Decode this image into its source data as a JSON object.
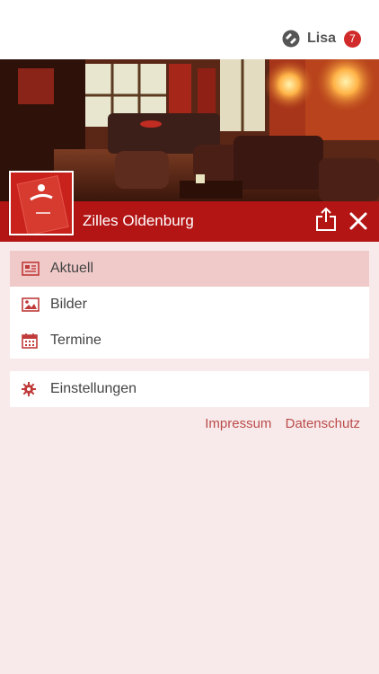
{
  "user": {
    "name": "Lisa",
    "badge_count": "7"
  },
  "venue": {
    "title": "Zilles Oldenburg"
  },
  "menu": {
    "primary": [
      {
        "label": "Aktuell",
        "icon": "newspaper-icon",
        "active": true
      },
      {
        "label": "Bilder",
        "icon": "image-icon",
        "active": false
      },
      {
        "label": "Termine",
        "icon": "calendar-icon",
        "active": false
      }
    ],
    "secondary": [
      {
        "label": "Einstellungen",
        "icon": "gear-icon"
      }
    ]
  },
  "footer_links": {
    "impressum": "Impressum",
    "datenschutz": "Datenschutz"
  },
  "colors": {
    "accent": "#b31414",
    "background": "#f8eaea",
    "active_row": "#f0c9c9",
    "link": "#bb4b4b"
  }
}
